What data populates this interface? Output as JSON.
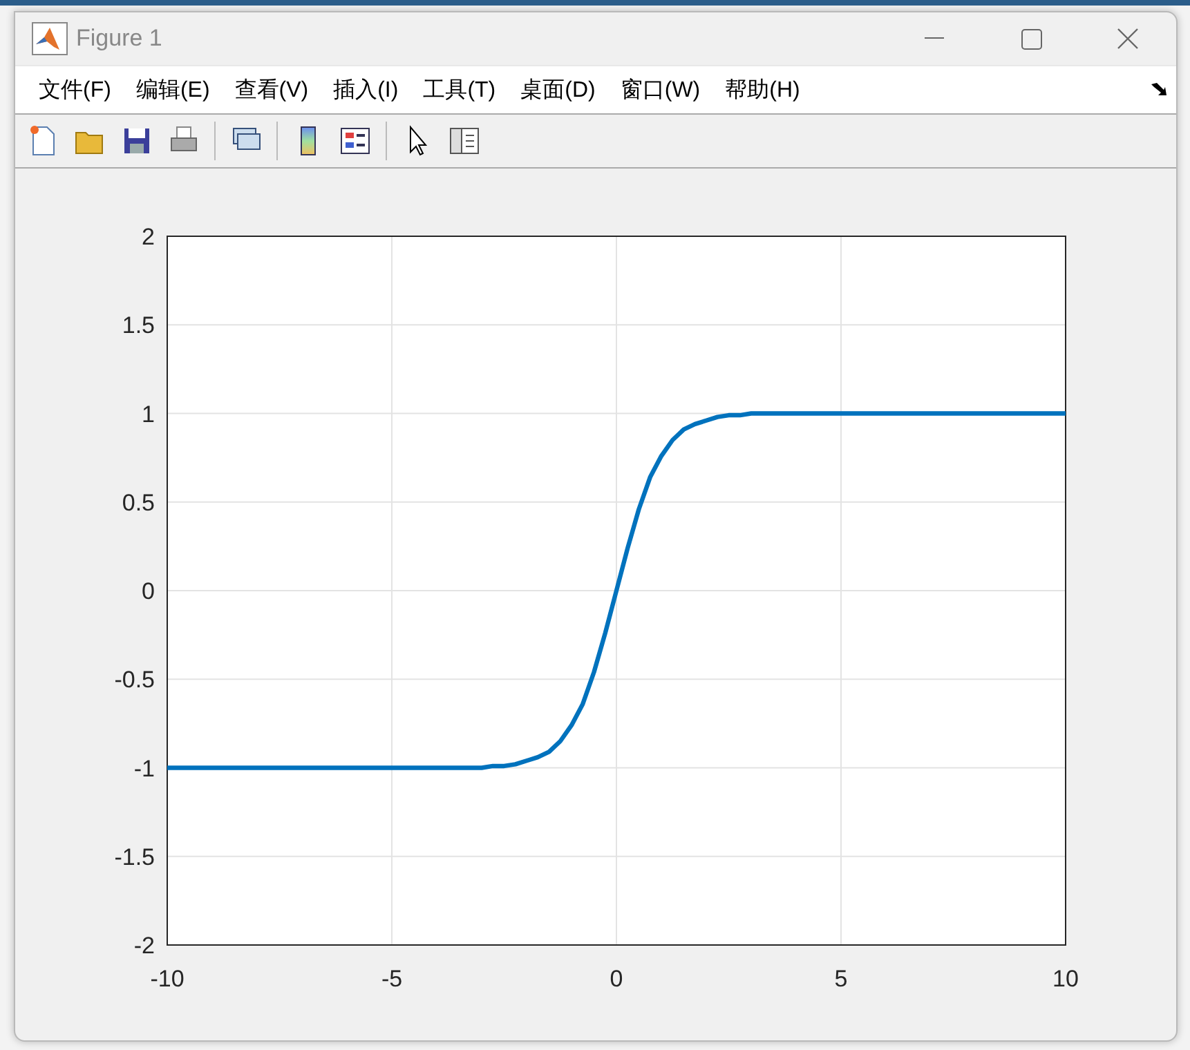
{
  "window": {
    "title": "Figure 1"
  },
  "menu": [
    "文件(F)",
    "编辑(E)",
    "查看(V)",
    "插入(I)",
    "工具(T)",
    "桌面(D)",
    "窗口(W)",
    "帮助(H)"
  ],
  "figure": {
    "chart_data": {
      "type": "line",
      "x": [
        -10,
        -9,
        -8,
        -7,
        -6,
        -5,
        -4,
        -3,
        -2.75,
        -2.5,
        -2.25,
        -2,
        -1.75,
        -1.5,
        -1.25,
        -1,
        -0.75,
        -0.5,
        -0.25,
        0,
        0.25,
        0.5,
        0.75,
        1,
        1.25,
        1.5,
        1.75,
        2,
        2.25,
        2.5,
        2.75,
        3,
        4,
        5,
        6,
        7,
        8,
        9,
        10
      ],
      "series": [
        {
          "color": "#0072bd",
          "values": [
            -1,
            -1,
            -1,
            -1,
            -1,
            -1,
            -1,
            -1,
            -0.99,
            -0.99,
            -0.98,
            -0.96,
            -0.94,
            -0.91,
            -0.85,
            -0.76,
            -0.64,
            -0.46,
            -0.24,
            0,
            0.24,
            0.46,
            0.64,
            0.76,
            0.85,
            0.91,
            0.94,
            0.96,
            0.98,
            0.99,
            0.99,
            1,
            1,
            1,
            1,
            1,
            1,
            1,
            1
          ]
        }
      ],
      "grid": true,
      "xlim": [
        -10,
        10
      ],
      "ylim": [
        -2,
        2
      ],
      "xticks": [
        -10,
        -5,
        0,
        5,
        10
      ],
      "yticks": [
        -2,
        -1.5,
        -1,
        -0.5,
        0,
        0.5,
        1,
        1.5,
        2
      ]
    }
  }
}
